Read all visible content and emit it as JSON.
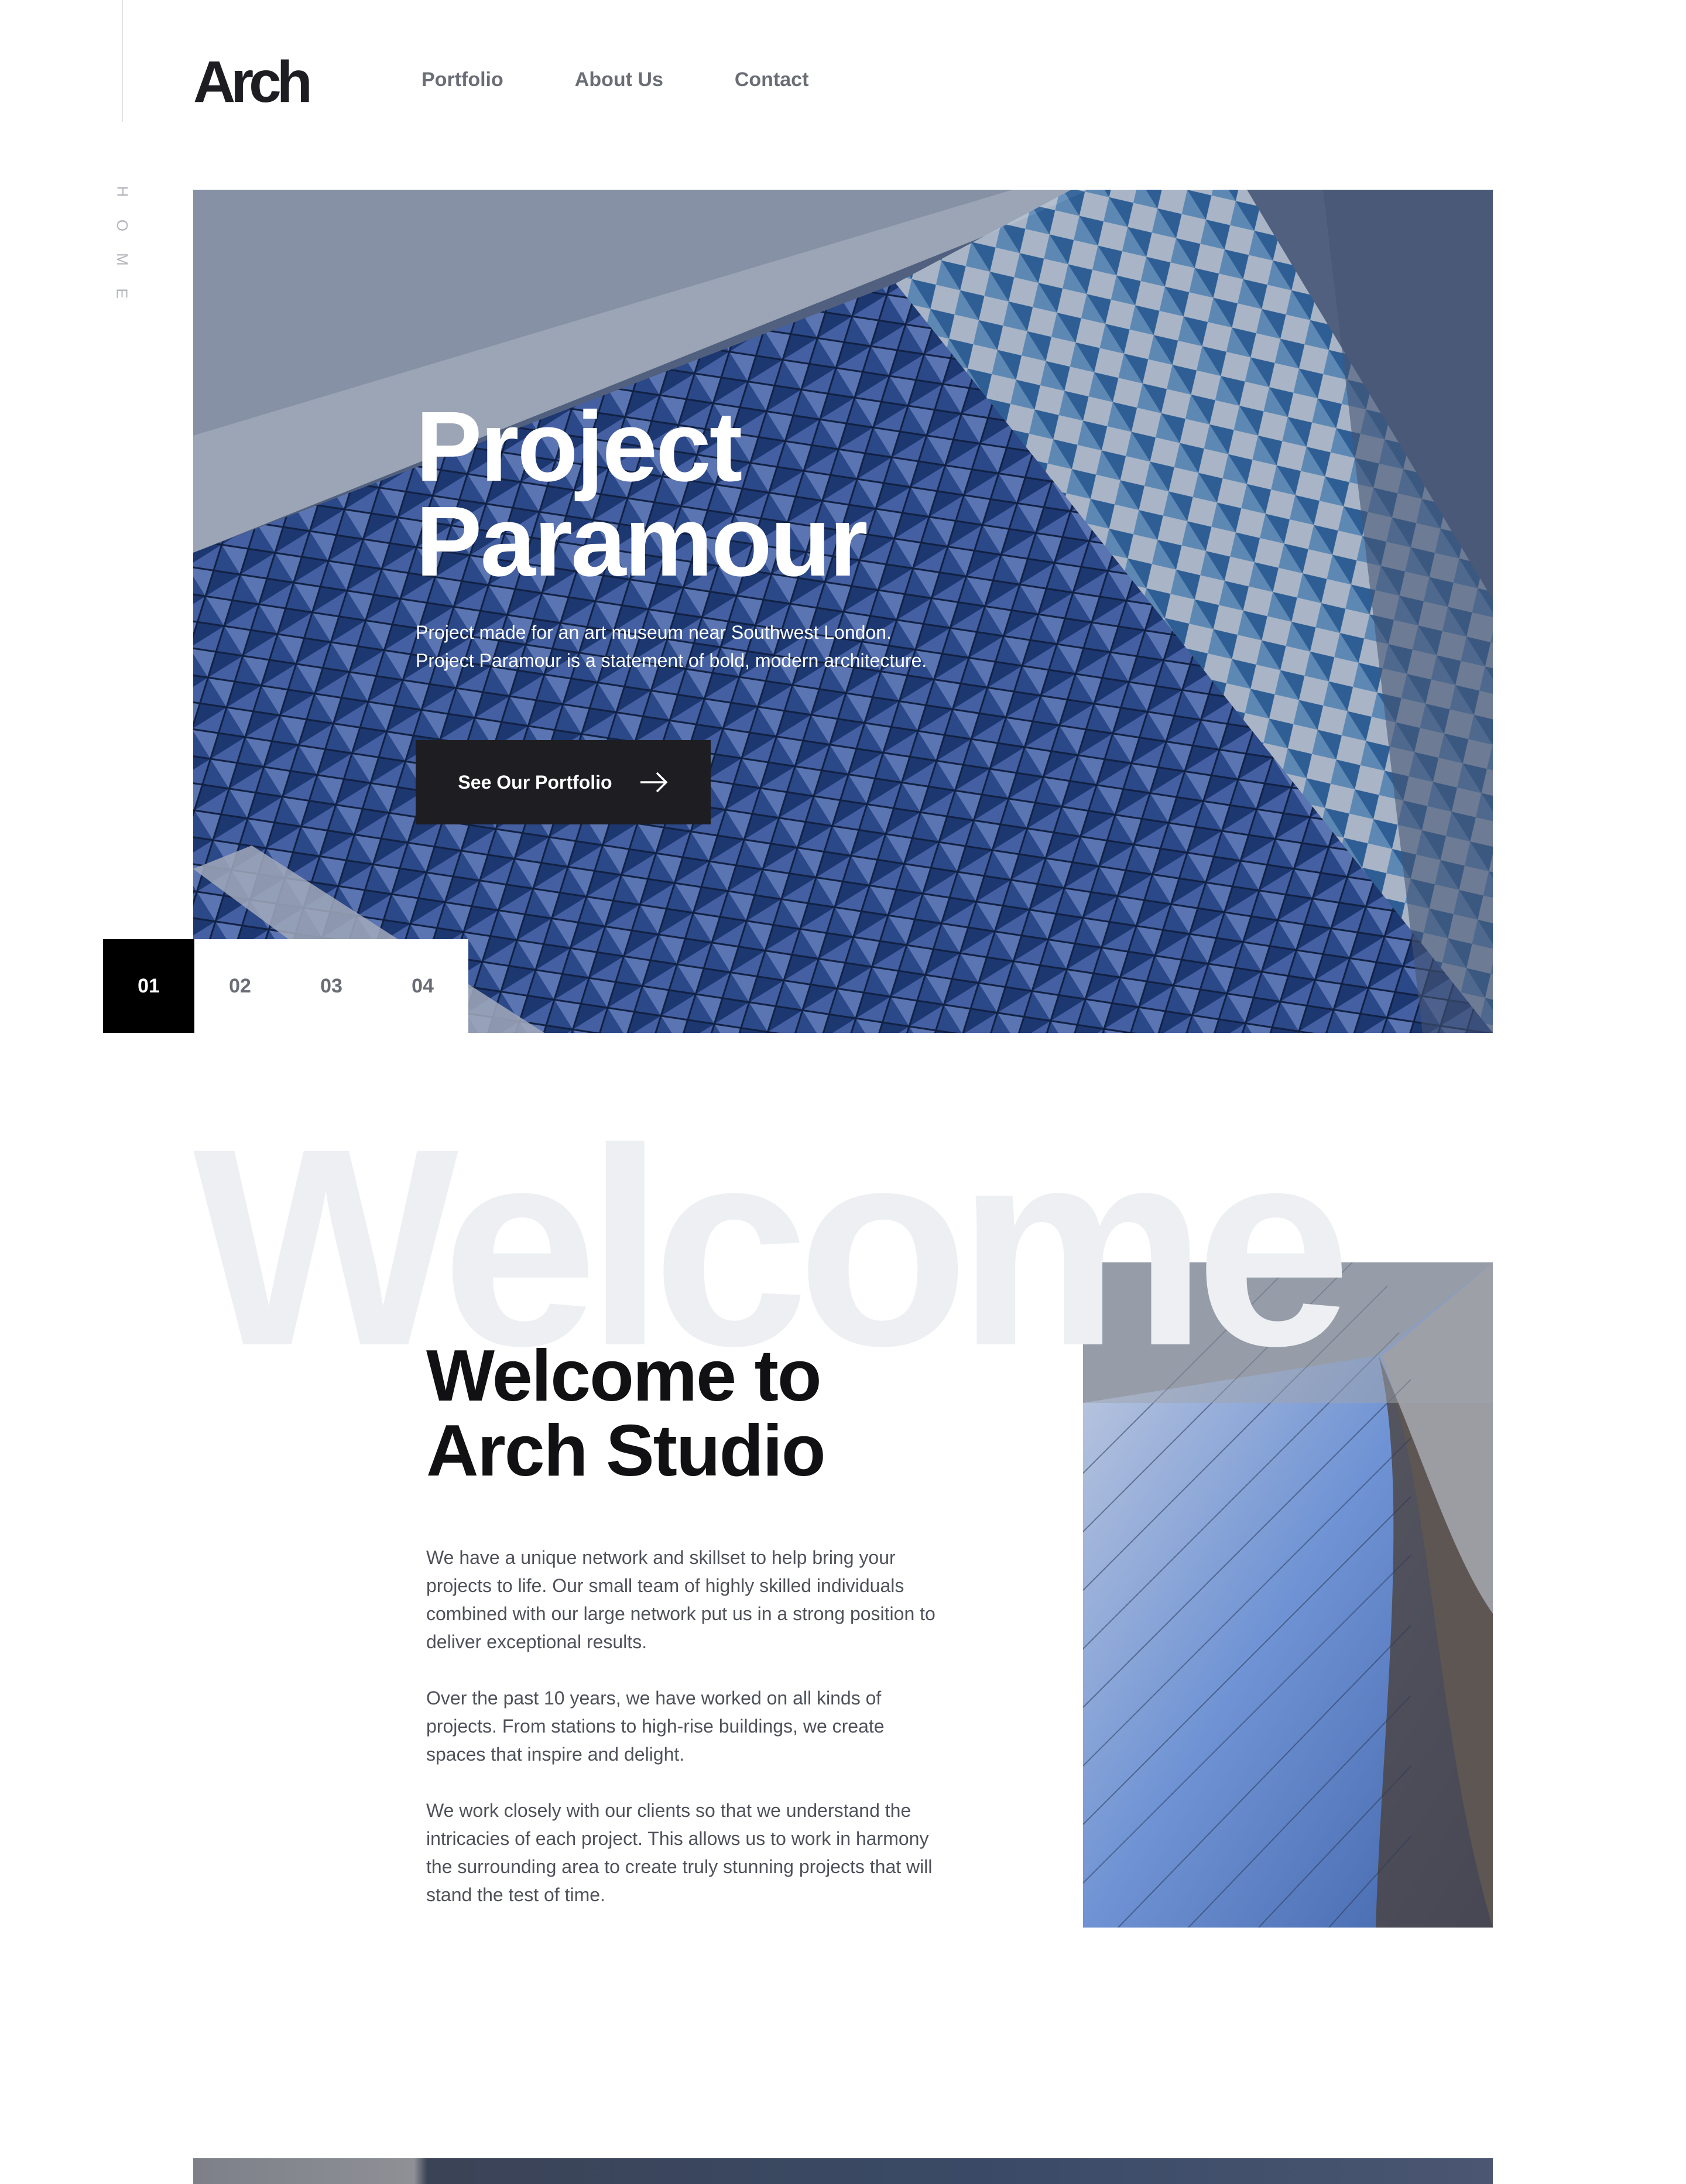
{
  "sidebar": {
    "page_label": [
      "H",
      "O",
      "M",
      "E"
    ]
  },
  "header": {
    "logo": "Arch",
    "nav": [
      {
        "label": "Portfolio"
      },
      {
        "label": "About Us"
      },
      {
        "label": "Contact"
      }
    ]
  },
  "hero": {
    "title_line1": "Project",
    "title_line2": "Paramour",
    "description": "Project made for an art museum near Southwest London. Project Paramour is a statement of bold, modern architecture.",
    "cta_label": "See Our Portfolio",
    "cta_icon": "arrow-right-icon"
  },
  "slider": {
    "tabs": [
      {
        "label": "01",
        "active": true
      },
      {
        "label": "02",
        "active": false
      },
      {
        "label": "03",
        "active": false
      },
      {
        "label": "04",
        "active": false
      }
    ]
  },
  "welcome": {
    "background_word": "Welcome",
    "title_line1": "Welcome to",
    "title_line2": "Arch Studio",
    "paragraphs": [
      "We have a unique network and skillset to help bring your projects to life. Our small team of highly skilled individuals combined with our large network put us in a strong position to deliver exceptional results.",
      "Over the past 10 years, we have worked on all kinds of projects. From stations to high-rise buildings, we create spaces that inspire and delight.",
      "We work closely with our clients so that we understand the intricacies of each project. This allows us to work in harmony the surrounding area to create truly stunning projects that will stand the test of time."
    ]
  },
  "colors": {
    "dark": "#1e1e22",
    "muted_text": "#6b6d76",
    "body_text": "#4f515a",
    "watermark": "#eeeff3",
    "active_tab": "#000000"
  }
}
